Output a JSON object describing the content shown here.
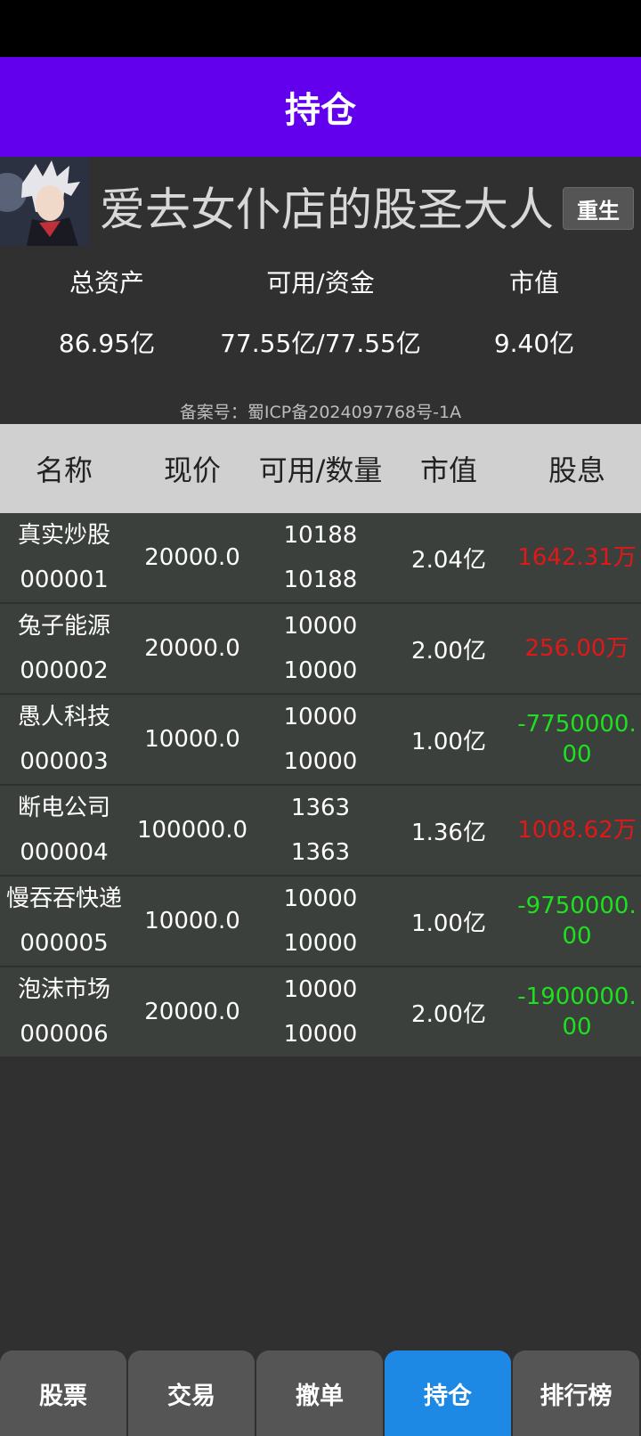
{
  "app_bar": {
    "title": "持仓"
  },
  "profile": {
    "username": "爱去女仆店的股圣大人",
    "reset_label": "重生"
  },
  "stats": [
    {
      "label": "总资产",
      "value": "86.95亿"
    },
    {
      "label": "可用/资金",
      "value": "77.55亿/77.55亿"
    },
    {
      "label": "市值",
      "value": "9.40亿"
    }
  ],
  "icp": "备案号：蜀ICP备2024097768号-1A",
  "table": {
    "headers": [
      "名称",
      "现价",
      "可用/数量",
      "市值",
      "股息"
    ],
    "rows": [
      {
        "name": "真实炒股",
        "code": "000001",
        "price": "20000.0",
        "available": "10188",
        "quantity": "10188",
        "market_value": "2.04亿",
        "dividend": "1642.31万",
        "dividend_sign": "positive"
      },
      {
        "name": "兔子能源",
        "code": "000002",
        "price": "20000.0",
        "available": "10000",
        "quantity": "10000",
        "market_value": "2.00亿",
        "dividend": "256.00万",
        "dividend_sign": "positive"
      },
      {
        "name": "愚人科技",
        "code": "000003",
        "price": "10000.0",
        "available": "10000",
        "quantity": "10000",
        "market_value": "1.00亿",
        "dividend": "-7750000.00",
        "dividend_sign": "negative"
      },
      {
        "name": "断电公司",
        "code": "000004",
        "price": "100000.0",
        "available": "1363",
        "quantity": "1363",
        "market_value": "1.36亿",
        "dividend": "1008.62万",
        "dividend_sign": "positive"
      },
      {
        "name": "慢吞吞快递",
        "code": "000005",
        "price": "10000.0",
        "available": "10000",
        "quantity": "10000",
        "market_value": "1.00亿",
        "dividend": "-9750000.00",
        "dividend_sign": "negative"
      },
      {
        "name": "泡沫市场",
        "code": "000006",
        "price": "20000.0",
        "available": "10000",
        "quantity": "10000",
        "market_value": "2.00亿",
        "dividend": "-1900000.00",
        "dividend_sign": "negative"
      }
    ]
  },
  "bottom_nav": [
    {
      "label": "股票",
      "active": false
    },
    {
      "label": "交易",
      "active": false
    },
    {
      "label": "撤单",
      "active": false
    },
    {
      "label": "持仓",
      "active": true
    },
    {
      "label": "排行榜",
      "active": false
    }
  ],
  "colors": {
    "app_bar": "#6200ee",
    "positive": "#e01818",
    "negative": "#1fe01f",
    "nav_active": "#1e88e5"
  }
}
